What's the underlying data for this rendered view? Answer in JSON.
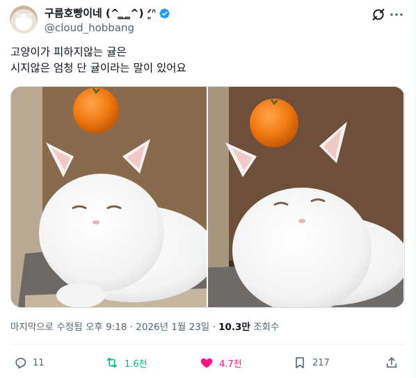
{
  "author": {
    "display_name": "구름호빵이네 (^ ̳ ̫ ̳^) ᐟ͈ᐢ",
    "handle": "@cloud_hobbang",
    "verified": true,
    "accent": "#1d9bf0"
  },
  "tweet": {
    "lines": [
      "고양이가 피하지않는 귤은",
      "시지않은 엄청 단 귤이라는 말이 있어요"
    ]
  },
  "media": {
    "photos": [
      "cat-with-tangerine-photo-1",
      "cat-with-tangerine-photo-2"
    ]
  },
  "meta": {
    "edited": "마지막으로 수정됨 오후 9:18",
    "sep": " · ",
    "date": "2026년 1월 23일",
    "views_count": "10.3만",
    "views_label": " 조회수"
  },
  "actions": {
    "reply": "11",
    "retweet": "1.6천",
    "like": "4.7천",
    "bookmark": "217"
  },
  "colors": {
    "retweet": "#00ba7c",
    "like": "#f91880",
    "muted": "#536471"
  }
}
